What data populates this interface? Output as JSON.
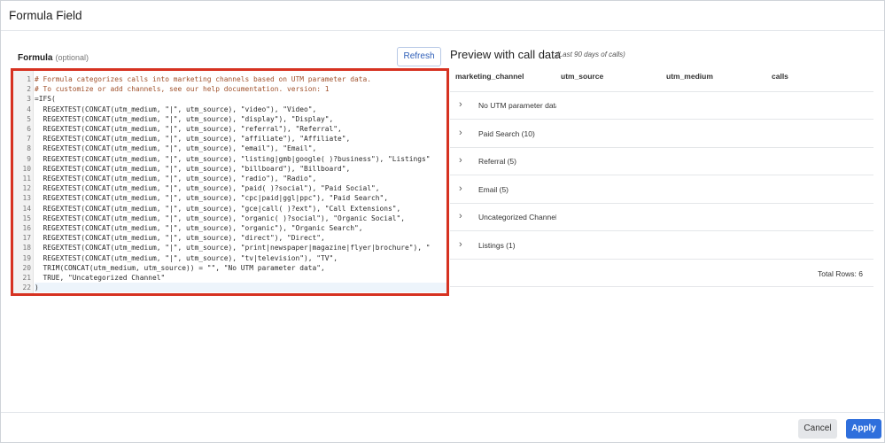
{
  "dialog": {
    "title": "Formula Field",
    "cancel_label": "Cancel",
    "apply_label": "Apply"
  },
  "formula": {
    "label": "Formula",
    "optional_label": "(optional)",
    "refresh_label": "Refresh",
    "active_line": 22,
    "lines": [
      "# Formula categorizes calls into marketing channels based on UTM parameter data.",
      "# To customize or add channels, see our help documentation. version: 1",
      "=IFS(",
      "  REGEXTEST(CONCAT(utm_medium, \"|\", utm_source), \"video\"), \"Video\",",
      "  REGEXTEST(CONCAT(utm_medium, \"|\", utm_source), \"display\"), \"Display\",",
      "  REGEXTEST(CONCAT(utm_medium, \"|\", utm_source), \"referral\"), \"Referral\",",
      "  REGEXTEST(CONCAT(utm_medium, \"|\", utm_source), \"affiliate\"), \"Affiliate\",",
      "  REGEXTEST(CONCAT(utm_medium, \"|\", utm_source), \"email\"), \"Email\",",
      "  REGEXTEST(CONCAT(utm_medium, \"|\", utm_source), \"listing|gmb|google( )?business\"), \"Listings\"",
      "  REGEXTEST(CONCAT(utm_medium, \"|\", utm_source), \"billboard\"), \"Billboard\",",
      "  REGEXTEST(CONCAT(utm_medium, \"|\", utm_source), \"radio\"), \"Radio\",",
      "  REGEXTEST(CONCAT(utm_medium, \"|\", utm_source), \"paid( )?social\"), \"Paid Social\",",
      "  REGEXTEST(CONCAT(utm_medium, \"|\", utm_source), \"cpc|paid|ggl|ppc\"), \"Paid Search\",",
      "  REGEXTEST(CONCAT(utm_medium, \"|\", utm_source), \"gce|call( )?ext\"), \"Call Extensions\",",
      "  REGEXTEST(CONCAT(utm_medium, \"|\", utm_source), \"organic( )?social\"), \"Organic Social\",",
      "  REGEXTEST(CONCAT(utm_medium, \"|\", utm_source), \"organic\"), \"Organic Search\",",
      "  REGEXTEST(CONCAT(utm_medium, \"|\", utm_source), \"direct\"), \"Direct\",",
      "  REGEXTEST(CONCAT(utm_medium, \"|\", utm_source), \"print|newspaper|magazine|flyer|brochure\"), \"",
      "  REGEXTEST(CONCAT(utm_medium, \"|\", utm_source), \"tv|television\"), \"TV\",",
      "  TRIM(CONCAT(utm_medium, utm_source)) = \"\", \"No UTM parameter data\",",
      "  TRUE, \"Uncategorized Channel\"",
      ")"
    ]
  },
  "preview": {
    "title": "Preview with call data",
    "subtitle": "(Last 90 days of calls)",
    "columns": [
      "marketing_channel",
      "utm_source",
      "utm_medium",
      "calls"
    ],
    "rows": [
      "No UTM parameter data",
      "Paid Search (10)",
      "Referral (5)",
      "Email (5)",
      "Uncategorized Channel (",
      "Listings (1)"
    ],
    "total_rows": "Total Rows: 6"
  }
}
